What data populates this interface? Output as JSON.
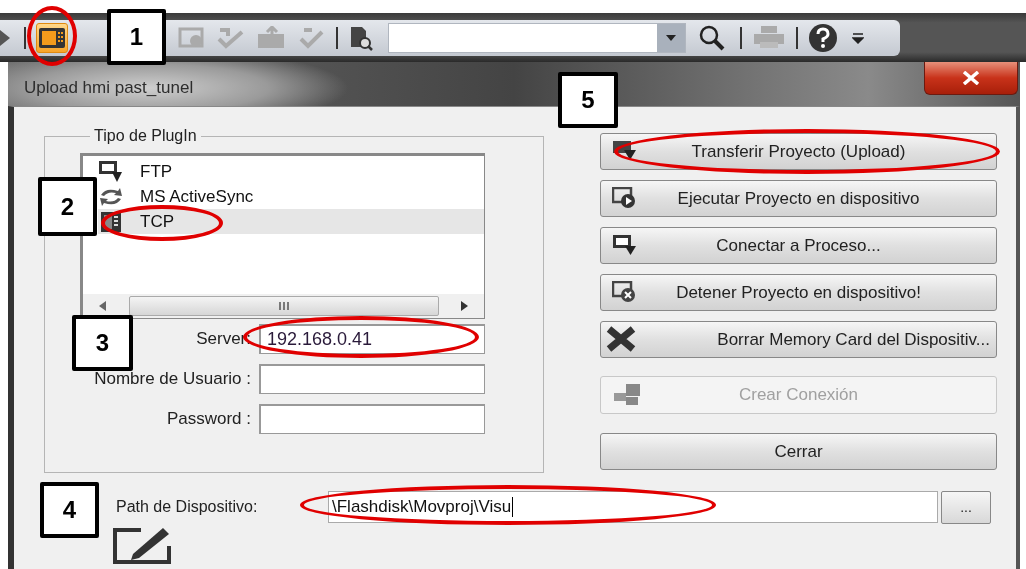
{
  "toolbar": {
    "device_button": {
      "active": true,
      "circled": true
    }
  },
  "dialog": {
    "title": "Upload hmi past_tunel"
  },
  "plugin_group": {
    "title": "Tipo de PlugIn",
    "items": [
      {
        "label": "FTP",
        "kind": "ftp",
        "selected": false,
        "circled": false
      },
      {
        "label": "MS ActiveSync",
        "kind": "sync",
        "selected": false,
        "circled": false
      },
      {
        "label": "TCP",
        "kind": "tcp",
        "selected": true,
        "circled": true
      }
    ]
  },
  "fields": [
    {
      "label": "Server:",
      "value": "192.168.0.41",
      "circled": true
    },
    {
      "label": "Nombre de Usuario :",
      "circled": false
    },
    {
      "label": "Password :",
      "circled": false
    }
  ],
  "actions": [
    {
      "label": "Transferir Proyecto (Upload)",
      "kind": "upload",
      "disabled": false,
      "circled": true
    },
    {
      "label": "Ejecutar Proyecto en dispositivo",
      "kind": "run",
      "disabled": false,
      "circled": false
    },
    {
      "label": "Conectar a Proceso...",
      "kind": "connect",
      "disabled": false,
      "circled": false
    },
    {
      "label": "Detener Proyecto en dispositivo!",
      "kind": "stop",
      "disabled": false,
      "circled": false
    },
    {
      "label": "Borrar Memory Card del Dispositiv...",
      "kind": "erase",
      "disabled": false,
      "circled": false
    },
    {
      "label": "Crear Conexión",
      "kind": "link",
      "disabled": true,
      "circled": false
    },
    {
      "label": "Cerrar",
      "kind": "close",
      "disabled": false,
      "circled": false
    }
  ],
  "path": {
    "label": "Path de Dispositivo:",
    "value": "\\Flashdisk\\Movproj\\Visu",
    "circled": true,
    "browse_label": "..."
  },
  "callouts": [
    {
      "number": "1"
    },
    {
      "number": "2"
    },
    {
      "number": "3"
    },
    {
      "number": "4"
    },
    {
      "number": "5"
    }
  ]
}
